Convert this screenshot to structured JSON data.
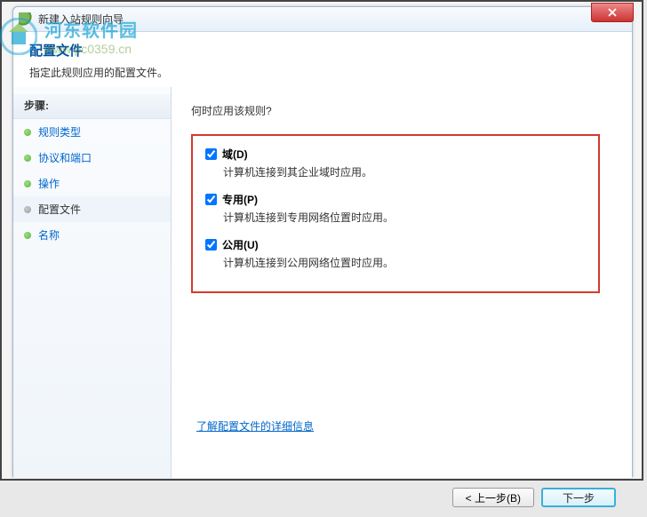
{
  "window": {
    "title": "新建入站规则向导"
  },
  "header": {
    "title": "配置文件",
    "subtitle": "指定此规则应用的配置文件。"
  },
  "sidebar": {
    "heading": "步骤:",
    "items": [
      {
        "label": "规则类型"
      },
      {
        "label": "协议和端口"
      },
      {
        "label": "操作"
      },
      {
        "label": "配置文件"
      },
      {
        "label": "名称"
      }
    ]
  },
  "main": {
    "question": "何时应用该规则?",
    "options": [
      {
        "label": "域(D)",
        "desc": "计算机连接到其企业域时应用。"
      },
      {
        "label": "专用(P)",
        "desc": "计算机连接到专用网络位置时应用。"
      },
      {
        "label": "公用(U)",
        "desc": "计算机连接到公用网络位置时应用。"
      }
    ],
    "learn_more": "了解配置文件的详细信息"
  },
  "buttons": {
    "back": "< 上一步(B)",
    "next": "下一步"
  },
  "watermark": {
    "site_name": "河东软件园",
    "site_url": "www.pc0359.cn"
  }
}
